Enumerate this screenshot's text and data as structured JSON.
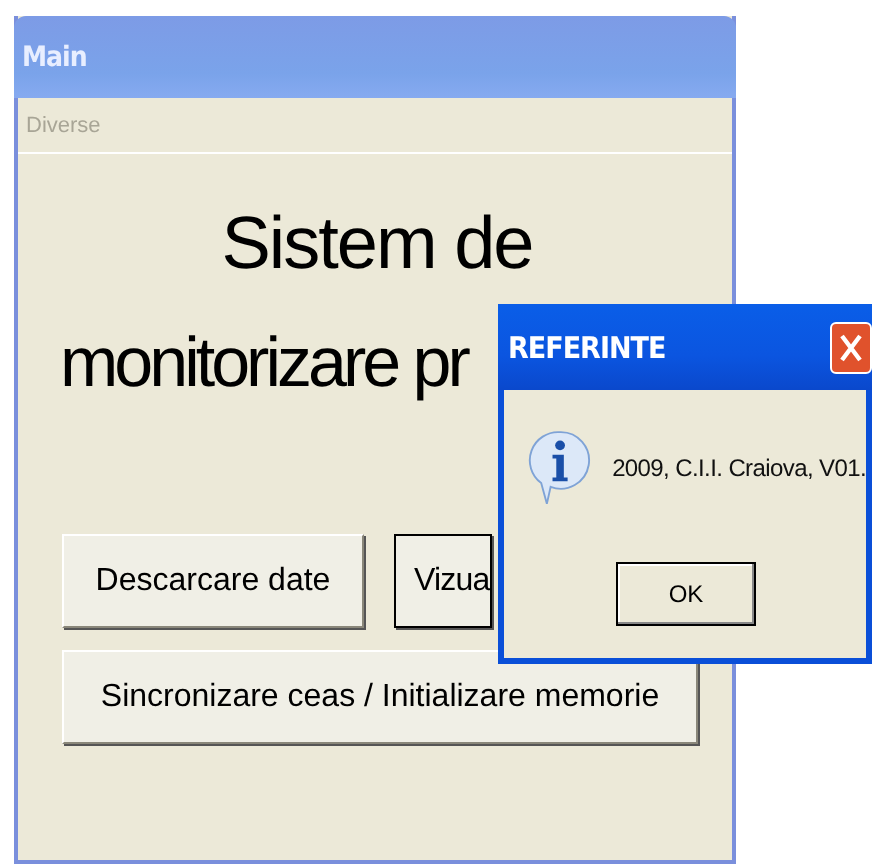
{
  "window": {
    "title": "Main"
  },
  "menu": [
    {
      "label": "Diverse",
      "disabled": true
    }
  ],
  "heading": [
    "Sistem de",
    "monitorizare pr"
  ],
  "buttons": [
    {
      "label": "Descarcare date"
    },
    {
      "label": "Vizua"
    },
    {
      "label": "Sincronizare ceas / Initializare memorie"
    }
  ],
  "dialog": {
    "title": "REFERINTE",
    "message": "2009, C.I.I. Craiova, V01.",
    "button": "OK"
  }
}
